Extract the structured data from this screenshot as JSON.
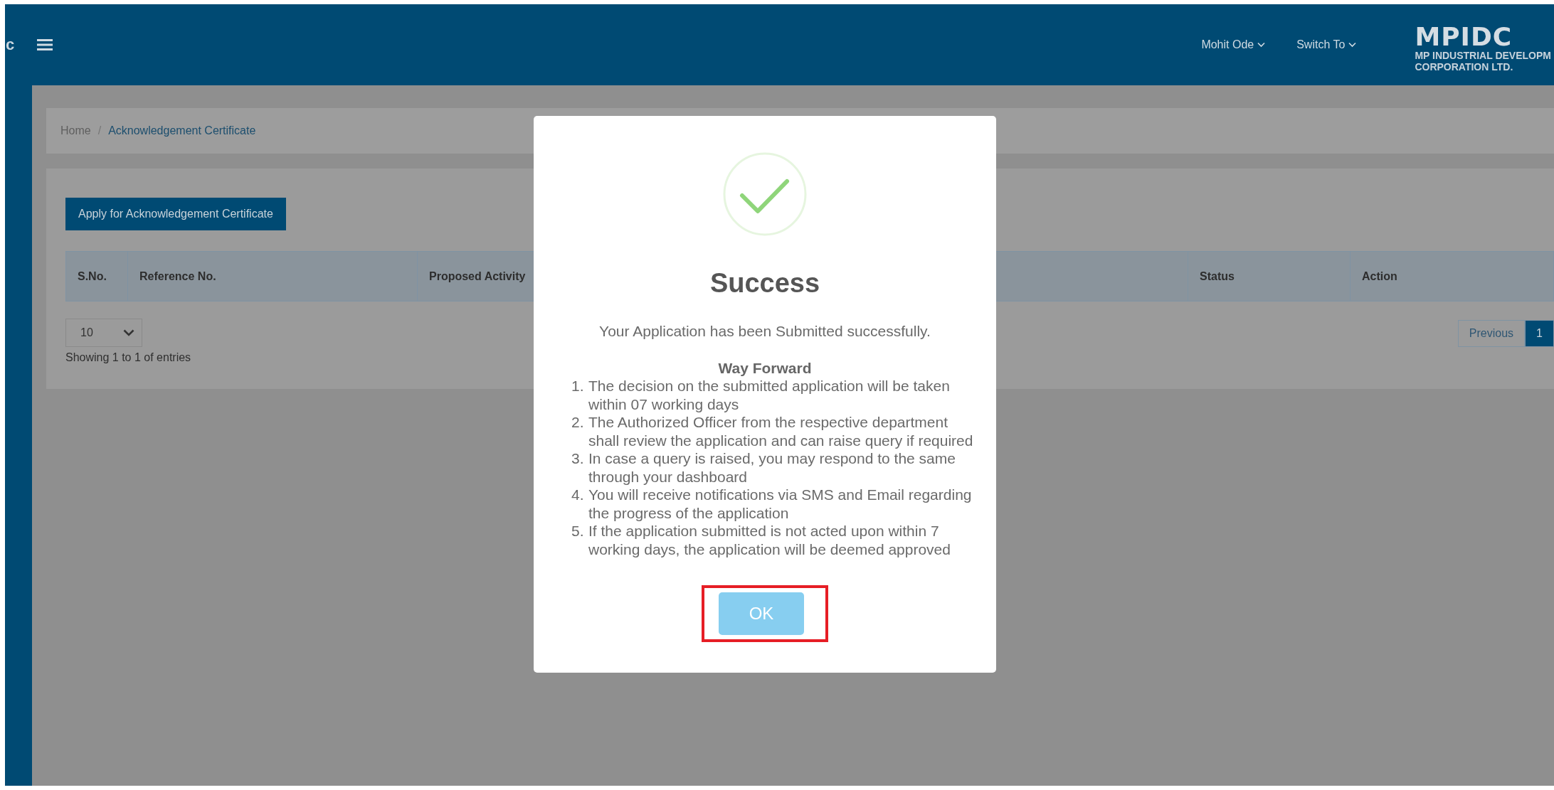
{
  "header": {
    "edge_text": "c",
    "menus": [
      {
        "label": "Mohit Ode"
      },
      {
        "label": "Switch To"
      }
    ],
    "logo": {
      "mark": "MPIDC",
      "line_1": "MP INDUSTRIAL DEVELOPM",
      "line_2": "CORPORATION LTD."
    }
  },
  "breadcrumb_separator": "/",
  "breadcrumb": [
    {
      "label": "Home",
      "current": false
    },
    {
      "label": "Acknowledgement Certificate",
      "current": true
    }
  ],
  "apply_button": "Apply for Acknowledgement Certificate",
  "table": {
    "columns": [
      "S.No.",
      "Reference No.",
      "Proposed Activity",
      "Status",
      "Action"
    ]
  },
  "page_size": "10",
  "entries_info": "Showing 1 to 1 of entries",
  "pagination": [
    {
      "label": "Previous",
      "selected": false
    },
    {
      "label": "1",
      "selected": true
    }
  ],
  "modal": {
    "title": "Success",
    "message": "Your Application has been Submitted successfully.",
    "subtitle": "Way Forward",
    "step_markers": [
      "1.",
      "2.",
      "3.",
      "4.",
      "5."
    ],
    "steps": [
      "The decision on the submitted application will be taken within 07 working days",
      "The Authorized Officer from the respective department shall review the application and can raise query if required",
      "In case a query is raised, you may respond to the same through your dashboard",
      "You will receive notifications via SMS and Email regarding the progress of the application",
      "If the application submitted is not acted upon within 7 working days, the application will be deemed approved"
    ],
    "ok_button": "OK",
    "ok_highlighted": true
  }
}
